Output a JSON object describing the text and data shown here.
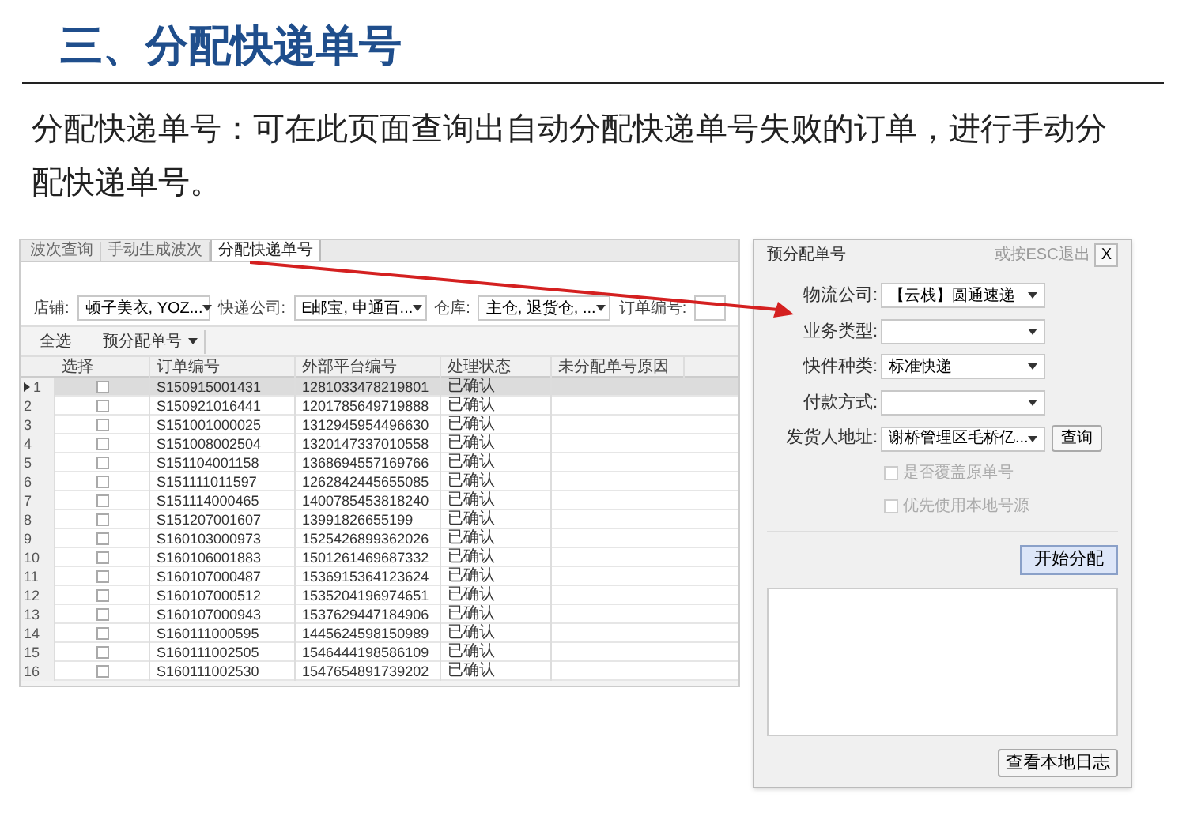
{
  "heading": "三、分配快递单号",
  "description": "分配快递单号：可在此页面查询出自动分配快递单号失败的订单，进行手动分配快递单号。",
  "app": {
    "tabs": [
      {
        "label": "波次查询",
        "selected": false
      },
      {
        "label": "手动生成波次",
        "selected": false
      },
      {
        "label": "分配快递单号",
        "selected": true
      }
    ],
    "filters": [
      {
        "label": "店铺:",
        "value": "顿子美衣, YOZ...",
        "kind": "select"
      },
      {
        "label": "快递公司:",
        "value": "E邮宝, 申通百...",
        "kind": "select"
      },
      {
        "label": "仓库:",
        "value": "主仓, 退货仓, ...",
        "kind": "select"
      },
      {
        "label": "订单编号:",
        "kind": "input"
      }
    ],
    "toolbar": {
      "select_all": "全选",
      "dropdown": "预分配单号"
    },
    "table": {
      "columns": [
        "选择",
        "订单编号",
        "外部平台编号",
        "处理状态",
        "未分配单号原因"
      ],
      "rows": [
        {
          "index": "1",
          "selected": true,
          "checked": false,
          "order_no": "S150915001431",
          "external_no": "1281033478219801",
          "status": "已确认"
        },
        {
          "index": "2",
          "selected": false,
          "checked": false,
          "order_no": "S150921016441",
          "external_no": "1201785649719888",
          "status": "已确认"
        },
        {
          "index": "3",
          "selected": false,
          "checked": false,
          "order_no": "S151001000025",
          "external_no": "1312945954496630",
          "status": "已确认"
        },
        {
          "index": "4",
          "selected": false,
          "checked": false,
          "order_no": "S151008002504",
          "external_no": "1320147337010558",
          "status": "已确认"
        },
        {
          "index": "5",
          "selected": false,
          "checked": false,
          "order_no": "S151104001158",
          "external_no": "1368694557169766",
          "status": "已确认"
        },
        {
          "index": "6",
          "selected": false,
          "checked": false,
          "order_no": "S151111011597",
          "external_no": "1262842445655085",
          "status": "已确认"
        },
        {
          "index": "7",
          "selected": false,
          "checked": false,
          "order_no": "S151114000465",
          "external_no": "1400785453818240",
          "status": "已确认"
        },
        {
          "index": "8",
          "selected": false,
          "checked": false,
          "order_no": "S151207001607",
          "external_no": "13991826655199",
          "status": "已确认"
        },
        {
          "index": "9",
          "selected": false,
          "checked": false,
          "order_no": "S160103000973",
          "external_no": "1525426899362026",
          "status": "已确认"
        },
        {
          "index": "10",
          "selected": false,
          "checked": false,
          "order_no": "S160106001883",
          "external_no": "1501261469687332",
          "status": "已确认"
        },
        {
          "index": "11",
          "selected": false,
          "checked": false,
          "order_no": "S160107000487",
          "external_no": "1536915364123624",
          "status": "已确认"
        },
        {
          "index": "12",
          "selected": false,
          "checked": false,
          "order_no": "S160107000512",
          "external_no": "1535204196974651",
          "status": "已确认"
        },
        {
          "index": "13",
          "selected": false,
          "checked": false,
          "order_no": "S160107000943",
          "external_no": "1537629447184906",
          "status": "已确认"
        },
        {
          "index": "14",
          "selected": false,
          "checked": false,
          "order_no": "S160111000595",
          "external_no": "1445624598150989",
          "status": "已确认"
        },
        {
          "index": "15",
          "selected": false,
          "checked": false,
          "order_no": "S160111002505",
          "external_no": "1546444198586109",
          "status": "已确认"
        },
        {
          "index": "16",
          "selected": false,
          "checked": false,
          "order_no": "S160111002530",
          "external_no": "1547654891739202",
          "status": "已确认"
        }
      ]
    }
  },
  "dialog": {
    "title": "预分配单号",
    "hint": "或按ESC退出",
    "close": "X",
    "fields": [
      {
        "label": "物流公司:",
        "value": "【云栈】圆通速递"
      },
      {
        "label": "业务类型:"
      },
      {
        "label": "快件种类:",
        "value": "标准快递"
      },
      {
        "label": "付款方式:"
      },
      {
        "label": "发货人地址:",
        "value": "谢桥管理区毛桥亿...",
        "button": "查询"
      }
    ],
    "options": [
      {
        "label": "是否覆盖原单号",
        "checked": false,
        "disabled": true
      },
      {
        "label": "优先使用本地号源",
        "checked": false,
        "disabled": true
      }
    ],
    "start_button": "开始分配",
    "log_button": "查看本地日志"
  }
}
